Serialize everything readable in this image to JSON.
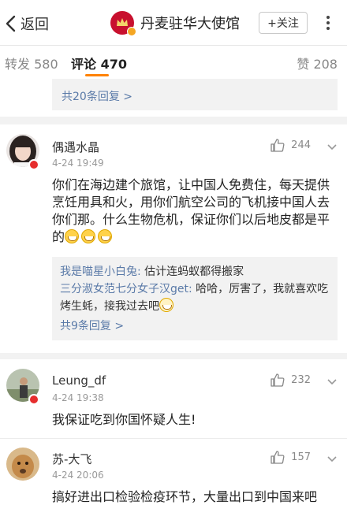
{
  "header": {
    "back_label": "返回",
    "account_name": "丹麦驻华大使馆",
    "follow_label": "+关注",
    "brand_color": "#c8102e"
  },
  "tabs": {
    "repost": "转发 580",
    "comment": "评论 470",
    "like": "赞 208",
    "accent_color": "#ff8200"
  },
  "top_replies_link": "共20条回复 >",
  "comments": [
    {
      "name": "偶遇水晶",
      "time": "4-24 19:49",
      "likes": "244",
      "text": "你们在海边建个旅馆，让中国人免费住，每天提供烹饪用具和火，用你们航空公司的飞机接中国人去你们那。什么生物危机，保证你们以后地皮都是平的",
      "emoji_count": 3,
      "replies": [
        {
          "user": "我是喵星小白兔:",
          "text": " 估计连蚂蚁都得搬家"
        },
        {
          "user": "三分淑女范七分女子汉get:",
          "text": " 哈哈，厉害了，我就喜欢吃烤生蚝，接我过去吧"
        }
      ],
      "more_replies": "共9条回复 >"
    },
    {
      "name": "Leung_df",
      "time": "4-24 19:38",
      "likes": "232",
      "text": "我保证吃到你国怀疑人生!"
    },
    {
      "name": "苏-大飞",
      "time": "4-24 20:06",
      "likes": "157",
      "text": "搞好进出口检验检疫环节，大量出口到中国来吧"
    }
  ]
}
